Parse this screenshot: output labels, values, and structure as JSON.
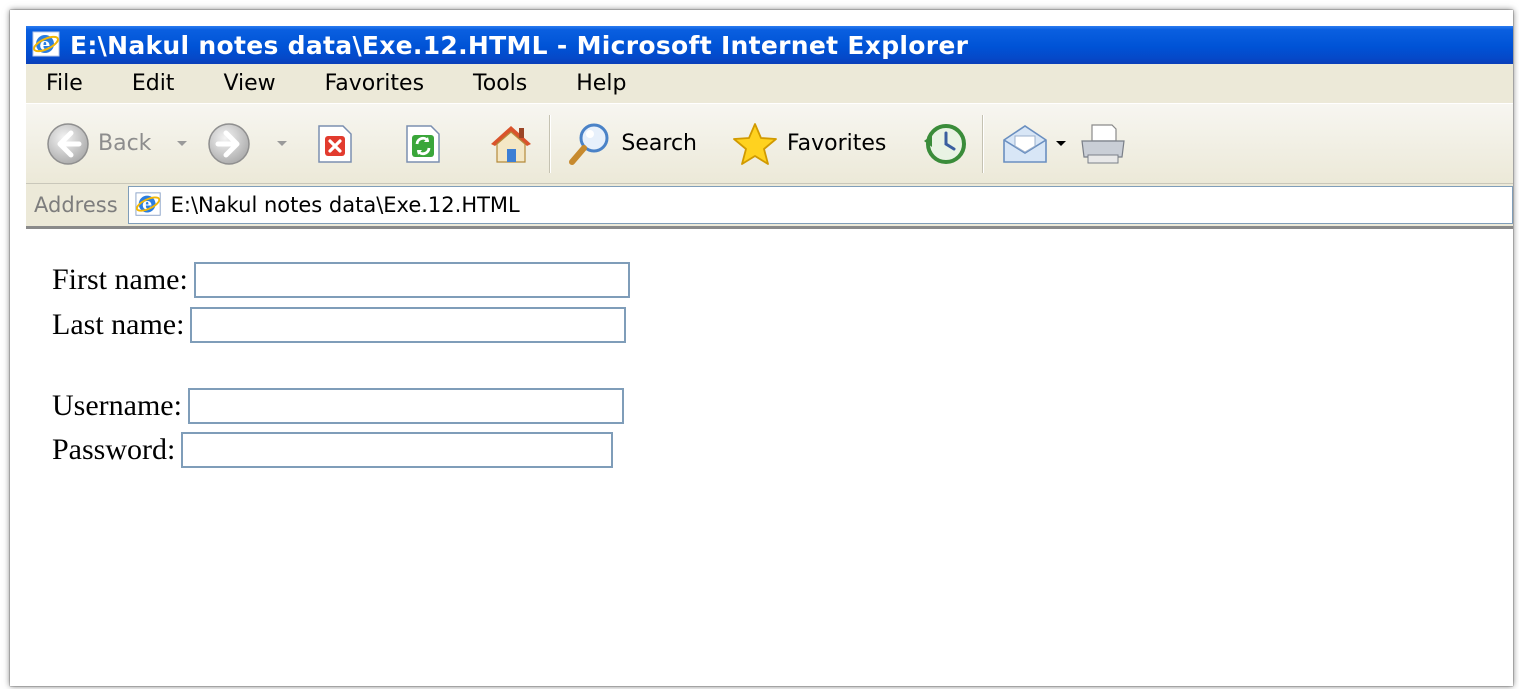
{
  "window": {
    "title": "E:\\Nakul notes data\\Exe.12.HTML - Microsoft Internet Explorer"
  },
  "menu": [
    "File",
    "Edit",
    "View",
    "Favorites",
    "Tools",
    "Help"
  ],
  "toolbar": {
    "back_label": "Back",
    "search_label": "Search",
    "favorites_label": "Favorites"
  },
  "address": {
    "label": "Address",
    "url": "E:\\Nakul notes data\\Exe.12.HTML"
  },
  "form": {
    "first_name_label": "First name:",
    "last_name_label": "Last name:",
    "username_label": "Username:",
    "password_label": "Password:",
    "first_name_value": "",
    "last_name_value": "",
    "username_value": "",
    "password_value": ""
  },
  "colors": {
    "titlebar": "#0053d6",
    "chrome": "#ece9d8",
    "input_border": "#7f9db9"
  }
}
